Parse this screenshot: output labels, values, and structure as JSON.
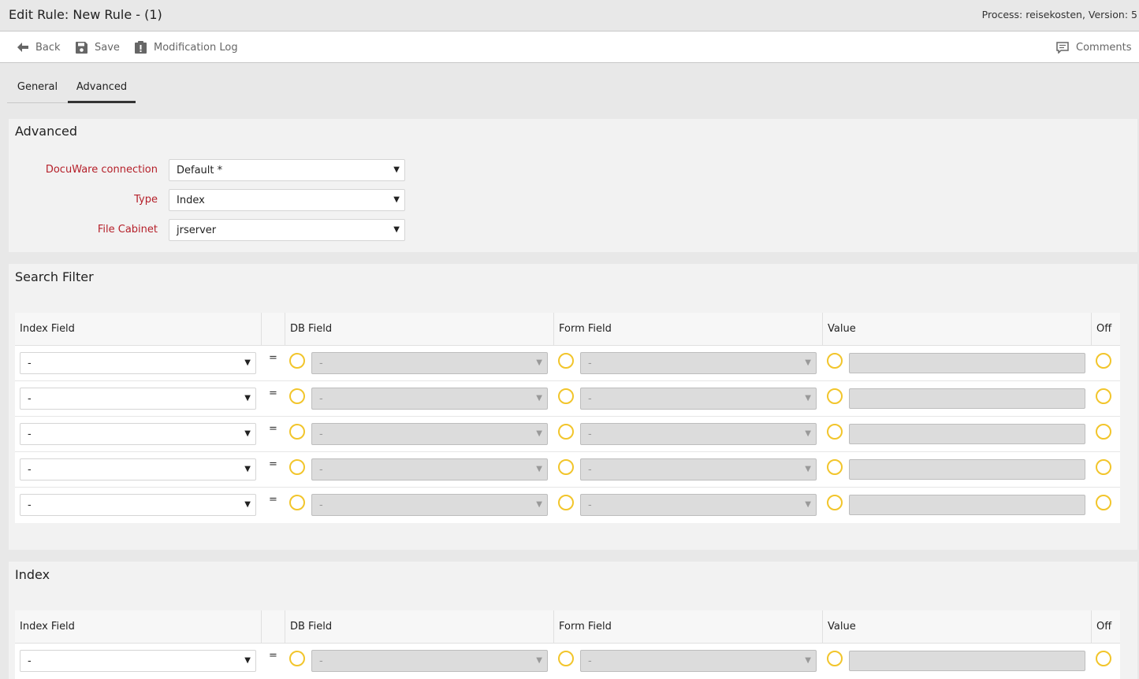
{
  "header": {
    "title": "Edit Rule: New Rule - (1)",
    "process": "Process: reisekosten, Version: 5"
  },
  "toolbar": {
    "back_label": "Back",
    "save_label": "Save",
    "log_label": "Modification Log",
    "comments_label": "Comments"
  },
  "tabs": [
    {
      "label": "General",
      "active": false
    },
    {
      "label": "Advanced",
      "active": true
    }
  ],
  "advanced": {
    "title": "Advanced",
    "fields": [
      {
        "label": "DocuWare connection",
        "value": "Default *"
      },
      {
        "label": "Type",
        "value": "Index"
      },
      {
        "label": "File Cabinet",
        "value": "jrserver"
      }
    ]
  },
  "search_filter": {
    "title": "Search Filter",
    "columns": {
      "index_field": "Index Field",
      "db_field": "DB Field",
      "form_field": "Form Field",
      "value": "Value",
      "off": "Off"
    },
    "rows": [
      {
        "index_field": "-",
        "eq": "=",
        "db_field": "-",
        "form_field": "-",
        "value": ""
      },
      {
        "index_field": "-",
        "eq": "=",
        "db_field": "-",
        "form_field": "-",
        "value": ""
      },
      {
        "index_field": "-",
        "eq": "=",
        "db_field": "-",
        "form_field": "-",
        "value": ""
      },
      {
        "index_field": "-",
        "eq": "=",
        "db_field": "-",
        "form_field": "-",
        "value": ""
      },
      {
        "index_field": "-",
        "eq": "=",
        "db_field": "-",
        "form_field": "-",
        "value": ""
      }
    ]
  },
  "index": {
    "title": "Index",
    "columns": {
      "index_field": "Index Field",
      "db_field": "DB Field",
      "form_field": "Form Field",
      "value": "Value",
      "off": "Off"
    },
    "rows": [
      {
        "index_field": "-",
        "eq": "=",
        "db_field": "-",
        "form_field": "-",
        "value": ""
      }
    ]
  },
  "colors": {
    "required_label": "#b5202a",
    "radio_ring": "#f2c52b"
  },
  "icons": {
    "back": "arrow-left-icon",
    "save": "floppy-disk-icon",
    "log": "clipboard-alert-icon",
    "comments": "speech-bubble-icon",
    "caret": "caret-down-icon"
  }
}
